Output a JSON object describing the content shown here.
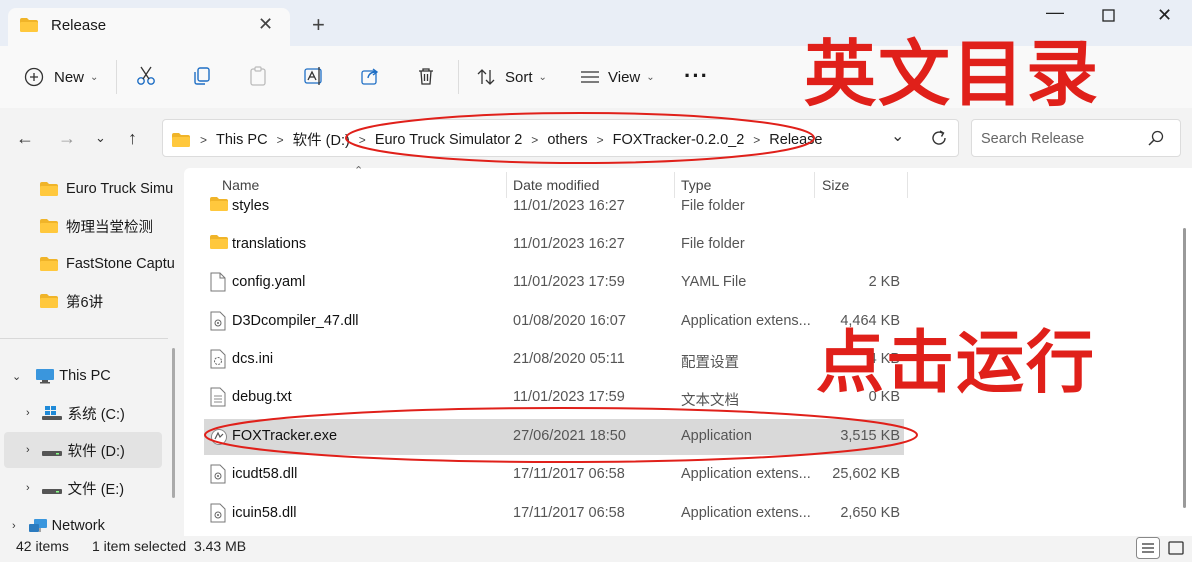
{
  "window": {
    "tab_title": "Release",
    "close_tab": "✕",
    "new_tab": "+",
    "minimize": "—",
    "close": "✕"
  },
  "toolbar": {
    "new_label": "New",
    "sort_label": "Sort",
    "view_label": "View",
    "more_label": "···"
  },
  "address": {
    "crumbs": [
      "This PC",
      "软件 (D:)",
      "Euro Truck Simulator 2",
      "others",
      "FOXTracker-0.2.0_2",
      "Release"
    ],
    "separator": ">"
  },
  "search": {
    "placeholder": "Search Release"
  },
  "sidebar": {
    "items": [
      {
        "label": "Euro Truck Simu",
        "icon": "folder-icon"
      },
      {
        "label": "物理当堂检测",
        "icon": "folder-icon"
      },
      {
        "label": "FastStone Captu",
        "icon": "folder-icon"
      },
      {
        "label": "第6讲",
        "icon": "folder-icon"
      },
      {
        "label": "This PC",
        "icon": "pc-icon"
      },
      {
        "label": "系统 (C:)",
        "icon": "drive-icon"
      },
      {
        "label": "软件 (D:)",
        "icon": "drive-icon"
      },
      {
        "label": "文件 (E:)",
        "icon": "drive-icon"
      },
      {
        "label": "Network",
        "icon": "network-icon"
      }
    ]
  },
  "columns": {
    "name": "Name",
    "date": "Date modified",
    "type": "Type",
    "size": "Size"
  },
  "files": [
    {
      "name": "styles",
      "date": "11/01/2023 16:27",
      "type": "File folder",
      "size": "",
      "icon": "folder-icon"
    },
    {
      "name": "translations",
      "date": "11/01/2023 16:27",
      "type": "File folder",
      "size": "",
      "icon": "folder-icon"
    },
    {
      "name": "config.yaml",
      "date": "11/01/2023 17:59",
      "type": "YAML File",
      "size": "2 KB",
      "icon": "file-icon"
    },
    {
      "name": "D3Dcompiler_47.dll",
      "date": "01/08/2020 16:07",
      "type": "Application extens...",
      "size": "4,464 KB",
      "icon": "dll-icon"
    },
    {
      "name": "dcs.ini",
      "date": "21/08/2020 05:11",
      "type": "配置设置",
      "size": "4 KB",
      "icon": "ini-icon"
    },
    {
      "name": "debug.txt",
      "date": "11/01/2023 17:59",
      "type": "文本文档",
      "size": "0 KB",
      "icon": "text-file-icon"
    },
    {
      "name": "FOXTracker.exe",
      "date": "27/06/2021 18:50",
      "type": "Application",
      "size": "3,515 KB",
      "icon": "exe-icon"
    },
    {
      "name": "icudt58.dll",
      "date": "17/11/2017 06:58",
      "type": "Application extens...",
      "size": "25,602 KB",
      "icon": "dll-icon"
    },
    {
      "name": "icuin58.dll",
      "date": "17/11/2017 06:58",
      "type": "Application extens...",
      "size": "2,650 KB",
      "icon": "dll-icon"
    }
  ],
  "status": {
    "items": "42 items",
    "selected": "1 item selected  3.43 MB"
  },
  "annotations": {
    "top": "英文目录",
    "middle": "点击运行",
    "color": "#e0201a"
  }
}
